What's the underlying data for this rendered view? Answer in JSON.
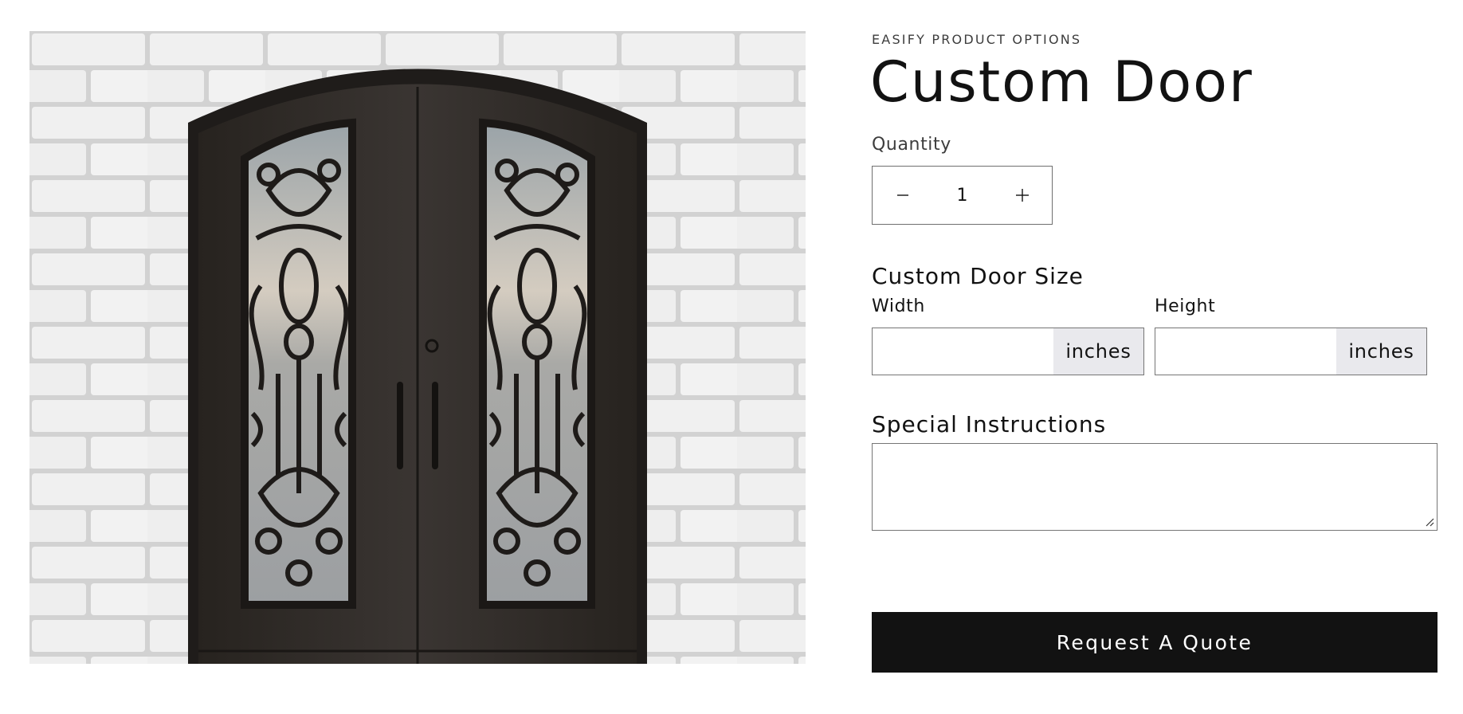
{
  "product": {
    "vendor": "EASIFY PRODUCT OPTIONS",
    "title": "Custom Door",
    "image_alt": "Arched black iron double door with ornate scrollwork over glass, set against a white brick wall"
  },
  "quantity": {
    "label": "Quantity",
    "value": "1",
    "decrease_icon": "minus-icon",
    "increase_icon": "plus-icon"
  },
  "size": {
    "heading": "Custom Door Size",
    "width_label": "Width",
    "height_label": "Height",
    "width_unit": "inches",
    "height_unit": "inches",
    "width_value": "",
    "height_value": ""
  },
  "instructions": {
    "heading": "Special Instructions",
    "value": ""
  },
  "cta": {
    "label": "Request A Quote"
  },
  "colors": {
    "button_bg": "#121212",
    "suffix_bg": "#e9e9ed",
    "door": "#2f2b28",
    "wall": "#ececec"
  }
}
